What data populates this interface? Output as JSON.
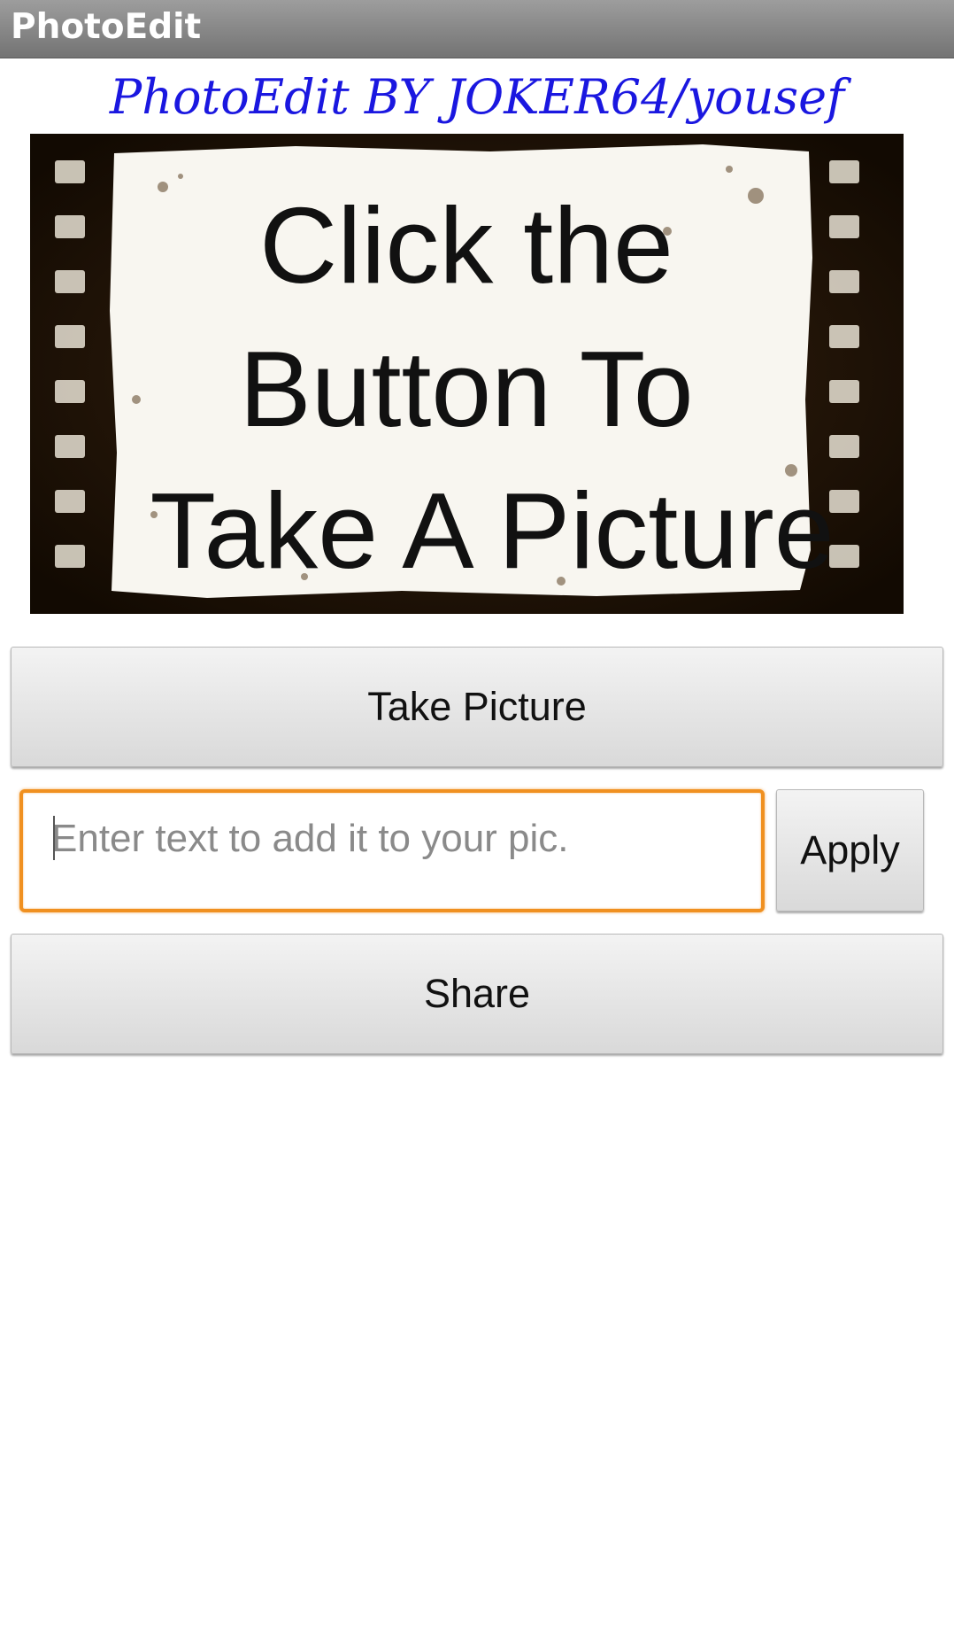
{
  "window": {
    "title": "PhotoEdit"
  },
  "header": {
    "text": "PhotoEdit BY JOKER64/yousef"
  },
  "image": {
    "line1": "Click the",
    "line2": "Button To",
    "line3": "Take A Picture"
  },
  "buttons": {
    "take_picture": "Take Picture",
    "apply": "Apply",
    "share": "Share"
  },
  "text_input": {
    "value": "",
    "placeholder": "Enter text to add it to your pic."
  },
  "colors": {
    "title_bar": "#8a8a8a",
    "heading_text": "#1a17e0",
    "input_focus_border": "#f09020"
  }
}
